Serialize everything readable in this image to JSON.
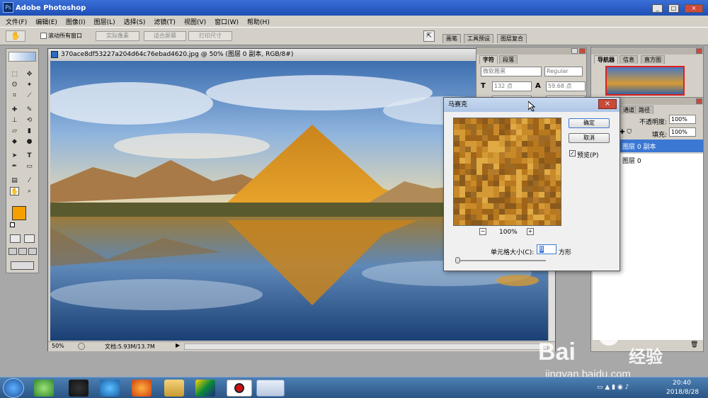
{
  "app": {
    "title": "Adobe Photoshop"
  },
  "window_buttons": {
    "min": "_",
    "max": "□",
    "close": "×"
  },
  "menu": [
    "文件(F)",
    "编辑(E)",
    "图像(I)",
    "图层(L)",
    "选择(S)",
    "滤镜(T)",
    "视图(V)",
    "窗口(W)",
    "帮助(H)"
  ],
  "options": {
    "scroll_all": "滚动所有窗口",
    "actual_pixels": "实际像素",
    "fit_screen": "适合屏幕",
    "print_size": "打印尺寸"
  },
  "palette_well": [
    "画笔",
    "工具预设",
    "图层复合"
  ],
  "document": {
    "title": "370ace8df53227a204d64c76ebad4620.jpg @ 50% (图层 0 副本, RGB/8#)",
    "zoom": "50%",
    "doc_info": "文档:5.93M/13.7M"
  },
  "character_panel": {
    "tabs": [
      "字符",
      "段落"
    ],
    "font": "微软雅黑",
    "style": "Regular",
    "size": "132 点",
    "leading": "59.68 点"
  },
  "navigator_panel": {
    "tabs": [
      "导航器",
      "信息",
      "直方图"
    ]
  },
  "layers_panel": {
    "tabs": [
      "通道",
      "路径"
    ],
    "opacity_label": "不透明度:",
    "opacity": "100%",
    "fill_label": "填充:",
    "fill": "100%",
    "layers": [
      {
        "name": "图层 0 副本",
        "selected": true
      },
      {
        "name": "图层 0",
        "selected": false
      }
    ]
  },
  "mosaic_dialog": {
    "title": "马赛克",
    "ok": "确定",
    "cancel": "取消",
    "preview": "预览(P)",
    "preview_checked": true,
    "zoom": "100%",
    "zoom_out": "−",
    "zoom_in": "+",
    "cell_size_label": "单元格大小(C):",
    "cell_size": "8",
    "unit": "方形"
  },
  "taskbar": {
    "time": "20:40",
    "date": "2018/8/28"
  },
  "watermark": {
    "brand": "Bai",
    "brand2": "经验",
    "url": "jingyan.baidu.com"
  },
  "colors": {
    "foreground": "#f5a000",
    "background": "#ffffff",
    "title_blue": "#2b5cc4",
    "layer_selected": "#3a78d4"
  }
}
